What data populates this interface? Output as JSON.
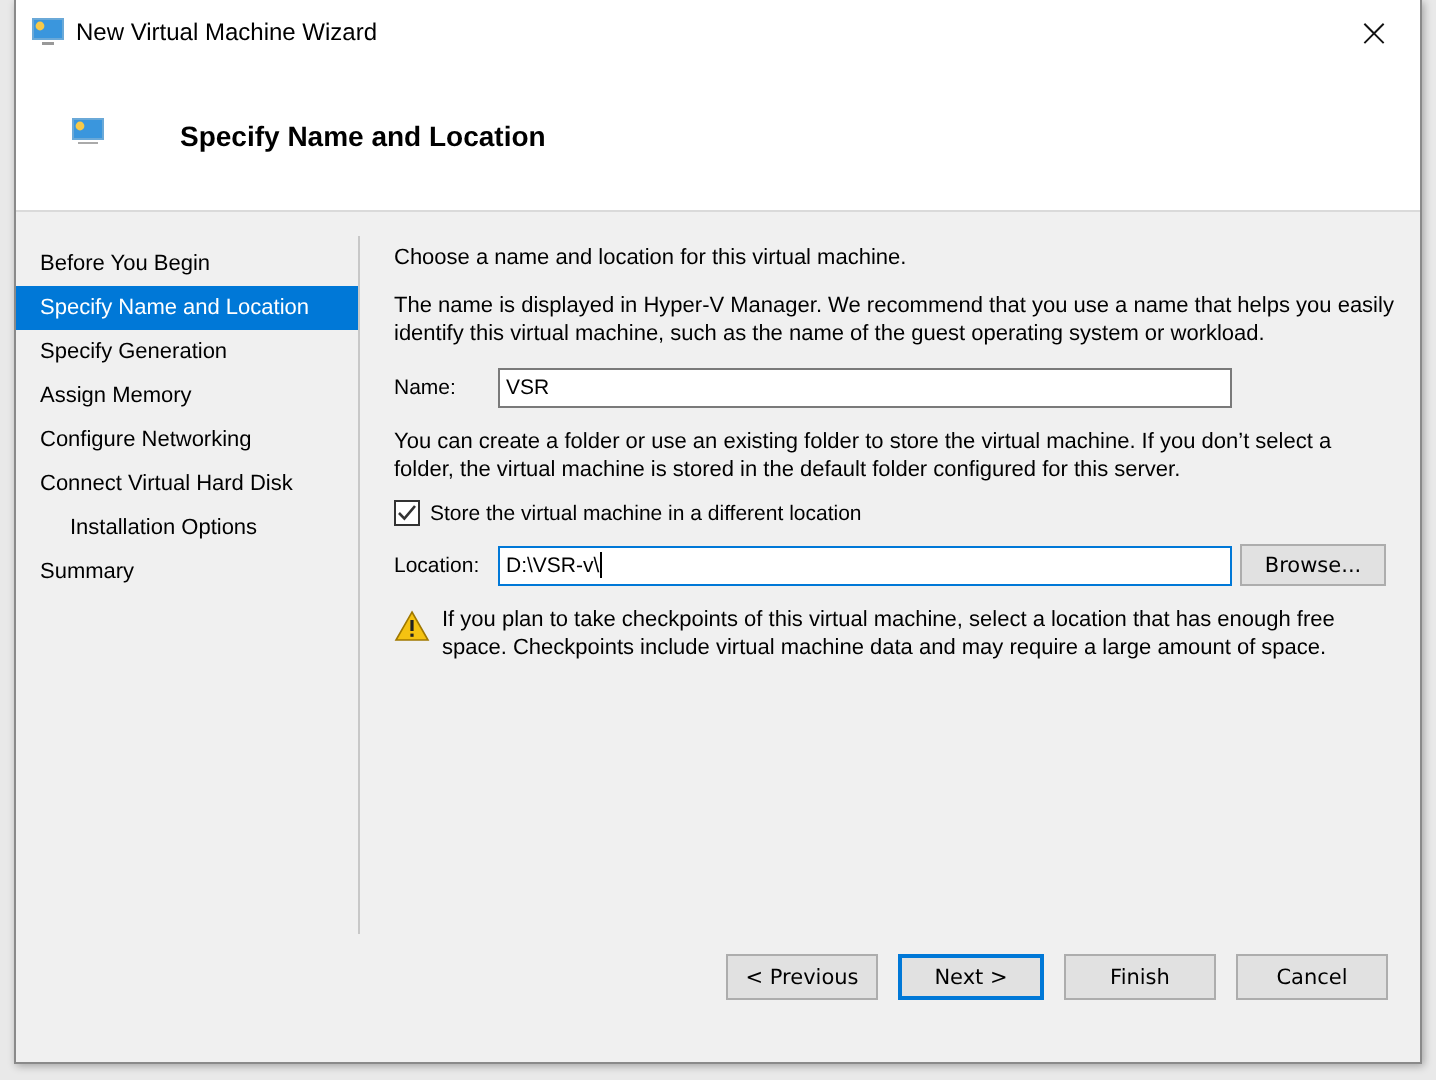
{
  "window": {
    "title": "New Virtual Machine Wizard",
    "close": "×"
  },
  "header": {
    "title": "Specify Name and Location"
  },
  "steps": [
    {
      "label": "Before You Begin",
      "selected": false
    },
    {
      "label": "Specify Name and Location",
      "selected": true
    },
    {
      "label": "Specify Generation",
      "selected": false
    },
    {
      "label": "Assign Memory",
      "selected": false
    },
    {
      "label": "Configure Networking",
      "selected": false
    },
    {
      "label": "Connect Virtual Hard Disk",
      "selected": false,
      "children": [
        {
          "label": "Installation Options",
          "selected": false
        }
      ]
    },
    {
      "label": "Summary",
      "selected": false
    }
  ],
  "content": {
    "intro": "Choose a name and location for this virtual machine.",
    "name_help": "The name is displayed in Hyper-V Manager. We recommend that you use a name that helps you easily identify this virtual machine, such as the name of the guest operating system or workload.",
    "name_label": "Name:",
    "name_value": "VSR",
    "folder_help": "You can create a folder or use an existing folder to store the virtual machine. If you don’t select a folder, the virtual machine is stored in the default folder configured for this server.",
    "store_checkbox": {
      "label": "Store the virtual machine in a different location",
      "checked": true
    },
    "location_label": "Location:",
    "location_value": "D:\\VSR-v\\",
    "browse": "Browse...",
    "warning": "If you plan to take checkpoints of this virtual machine, select a location that has enough free space. Checkpoints include virtual machine data and may require a large amount of space."
  },
  "buttons": [
    {
      "label": "< Previous",
      "selected": false
    },
    {
      "label": "Next >",
      "selected": true
    },
    {
      "label": "Finish",
      "selected": false
    },
    {
      "label": "Cancel",
      "selected": false
    }
  ]
}
